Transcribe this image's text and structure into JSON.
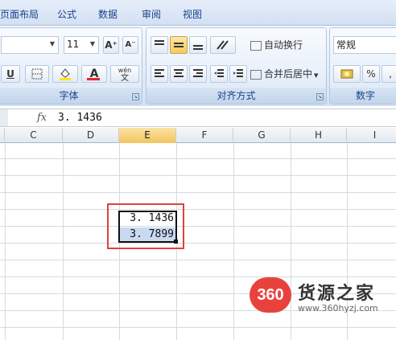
{
  "tabs": [
    "页面布局",
    "公式",
    "数据",
    "审阅",
    "视图"
  ],
  "font_group": {
    "label": "字体",
    "size_value": "11",
    "font_color_label": "A",
    "wen_label": "wén",
    "wen_char": "文",
    "underline_label": "U",
    "grow_label": "A⁺",
    "shrink_label": "A⁻"
  },
  "align_group": {
    "label": "对齐方式",
    "wrap_label": "自动换行",
    "merge_label": "合并后居中"
  },
  "number_group": {
    "label": "数字",
    "format_value": "常规",
    "percent_label": "%"
  },
  "formula_bar": {
    "fx_label": "fx",
    "value": "3. 1436"
  },
  "columns": [
    "C",
    "D",
    "E",
    "F",
    "G",
    "H",
    "I"
  ],
  "selected_column": "E",
  "cells": [
    "3. 1436",
    "3. 7899"
  ],
  "colors": {
    "highlight": "#e04040",
    "selection_fill": "#c9d9f1",
    "active_header": "#f3c560",
    "ribbon_text": "#15428b"
  },
  "watermark": {
    "logo": "360",
    "title": "货源之家",
    "url": "www.360hyzj.com"
  }
}
